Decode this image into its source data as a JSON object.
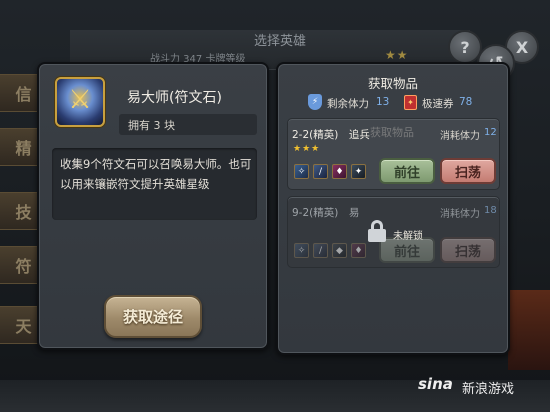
{
  "background": {
    "title": "选择英雄",
    "strip_text": "战斗力 347   卡牌等级",
    "stars": "★★",
    "side_tabs": [
      "信",
      "精",
      "技",
      "符",
      "天"
    ],
    "help_icon": "?",
    "close_icon": "X"
  },
  "item_panel": {
    "name": "易大师(符文石)",
    "owned": "拥有 3 块",
    "description": "收集9个符文石可以召唤易大师。也可以用来镶嵌符文提升英雄星级",
    "obtain_button": "获取途径"
  },
  "acquire_panel": {
    "title": "获取物品",
    "stamina_label": "剩余体力",
    "stamina_value": "13",
    "ticket_label": "极速券",
    "ticket_value": "78",
    "stages": [
      {
        "name": "2-2(精英)　追兵",
        "ghost_title": "获取物品",
        "cost_label": "消耗体力",
        "cost_value": "12",
        "stars": "★★★",
        "go_button": "前往",
        "sweep_button": "扫荡",
        "locked": false
      },
      {
        "name": "9-2(精英)　易",
        "cost_label": "消耗体力",
        "cost_value": "18",
        "lock_text": "未解锁",
        "go_button": "前往",
        "sweep_button": "扫荡",
        "locked": true
      }
    ]
  },
  "watermark": {
    "logo": "sina",
    "text": "新浪游戏"
  },
  "colors": {
    "panel_bg": "#3a3f45",
    "stone_button": "#b09c7c",
    "go_button": "#a9c09a",
    "sweep_button": "#e0a8a0",
    "value_blue": "#7fb0e8",
    "star_gold": "#f0c030"
  }
}
